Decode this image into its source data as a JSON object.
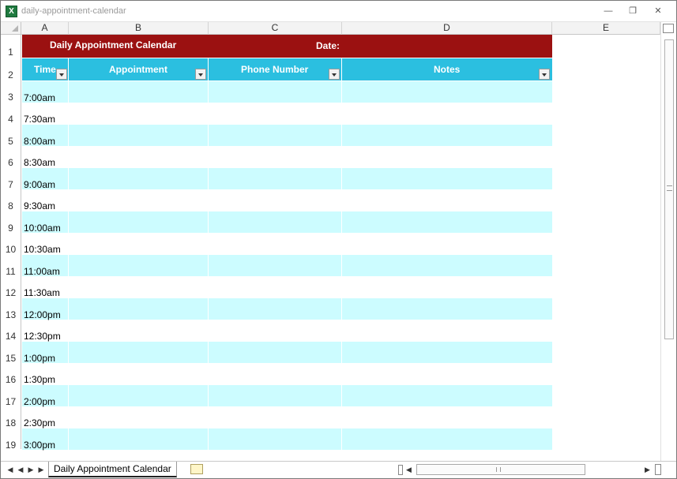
{
  "window": {
    "title": "daily-appointment-calendar"
  },
  "columns": [
    "A",
    "B",
    "C",
    "D",
    "E"
  ],
  "rows": [
    "1",
    "2",
    "3",
    "4",
    "5",
    "6",
    "7",
    "8",
    "9",
    "10",
    "11",
    "12",
    "13",
    "14",
    "15",
    "16",
    "17",
    "18",
    "19"
  ],
  "header": {
    "title": "Daily Appointment Calendar",
    "date_label": "Date:",
    "time": "Time",
    "appointment": "Appointment",
    "phone": "Phone Number",
    "notes": "Notes"
  },
  "times": [
    "7:00am",
    "7:30am",
    "8:00am",
    "8:30am",
    "9:00am",
    "9:30am",
    "10:00am",
    "10:30am",
    "11:00am",
    "11:30am",
    "12:00pm",
    "12:30pm",
    "1:00pm",
    "1:30pm",
    "2:00pm",
    "2:30pm",
    "3:00pm"
  ],
  "sheet_tab": "Daily Appointment Calendar",
  "colors": {
    "title_band": "#9b1111",
    "header_band": "#2bbfe0",
    "row_band": "#ccfcff"
  }
}
